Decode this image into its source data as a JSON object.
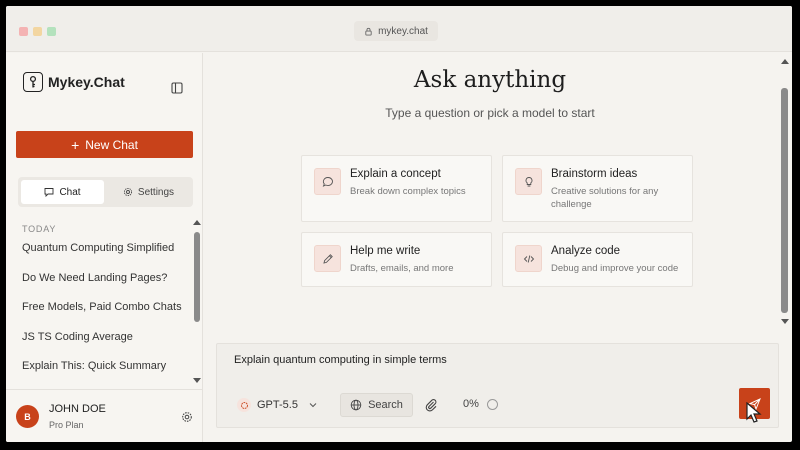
{
  "browser": {
    "url": "mykey.chat"
  },
  "sidebar": {
    "brand": "Mykey.Chat",
    "new_chat_label": "New Chat",
    "tabs": [
      {
        "label": "Chat",
        "icon": "chat-bubble-icon",
        "active": true
      },
      {
        "label": "Settings",
        "icon": "gear-icon",
        "active": false
      }
    ],
    "section_label": "TODAY",
    "chats": [
      "Quantum Computing Simplified",
      "Do We Need Landing Pages?",
      "Free Models, Paid Combo Chats",
      "JS TS Coding Average",
      "Explain This: Quick Summary"
    ],
    "user": {
      "initial": "B",
      "name": "JOHN DOE",
      "plan": "Pro Plan"
    }
  },
  "main": {
    "headline": "Ask anything",
    "subline": "Type a question or pick a model to start",
    "cards": [
      {
        "title": "Explain a concept",
        "desc": "Break down complex topics",
        "icon": "chat-bubble-icon"
      },
      {
        "title": "Brainstorm ideas",
        "desc": "Creative solutions for any challenge",
        "icon": "lightbulb-icon"
      },
      {
        "title": "Help me write",
        "desc": "Drafts, emails, and more",
        "icon": "pen-icon"
      },
      {
        "title": "Analyze code",
        "desc": "Debug and improve your code",
        "icon": "code-icon"
      }
    ],
    "composer": {
      "text": "Explain quantum computing in simple terms",
      "model": "GPT-5.5",
      "search_label": "Search",
      "usage": "0%"
    }
  },
  "colors": {
    "accent": "#c8421a",
    "background": "#f5f3ef"
  }
}
